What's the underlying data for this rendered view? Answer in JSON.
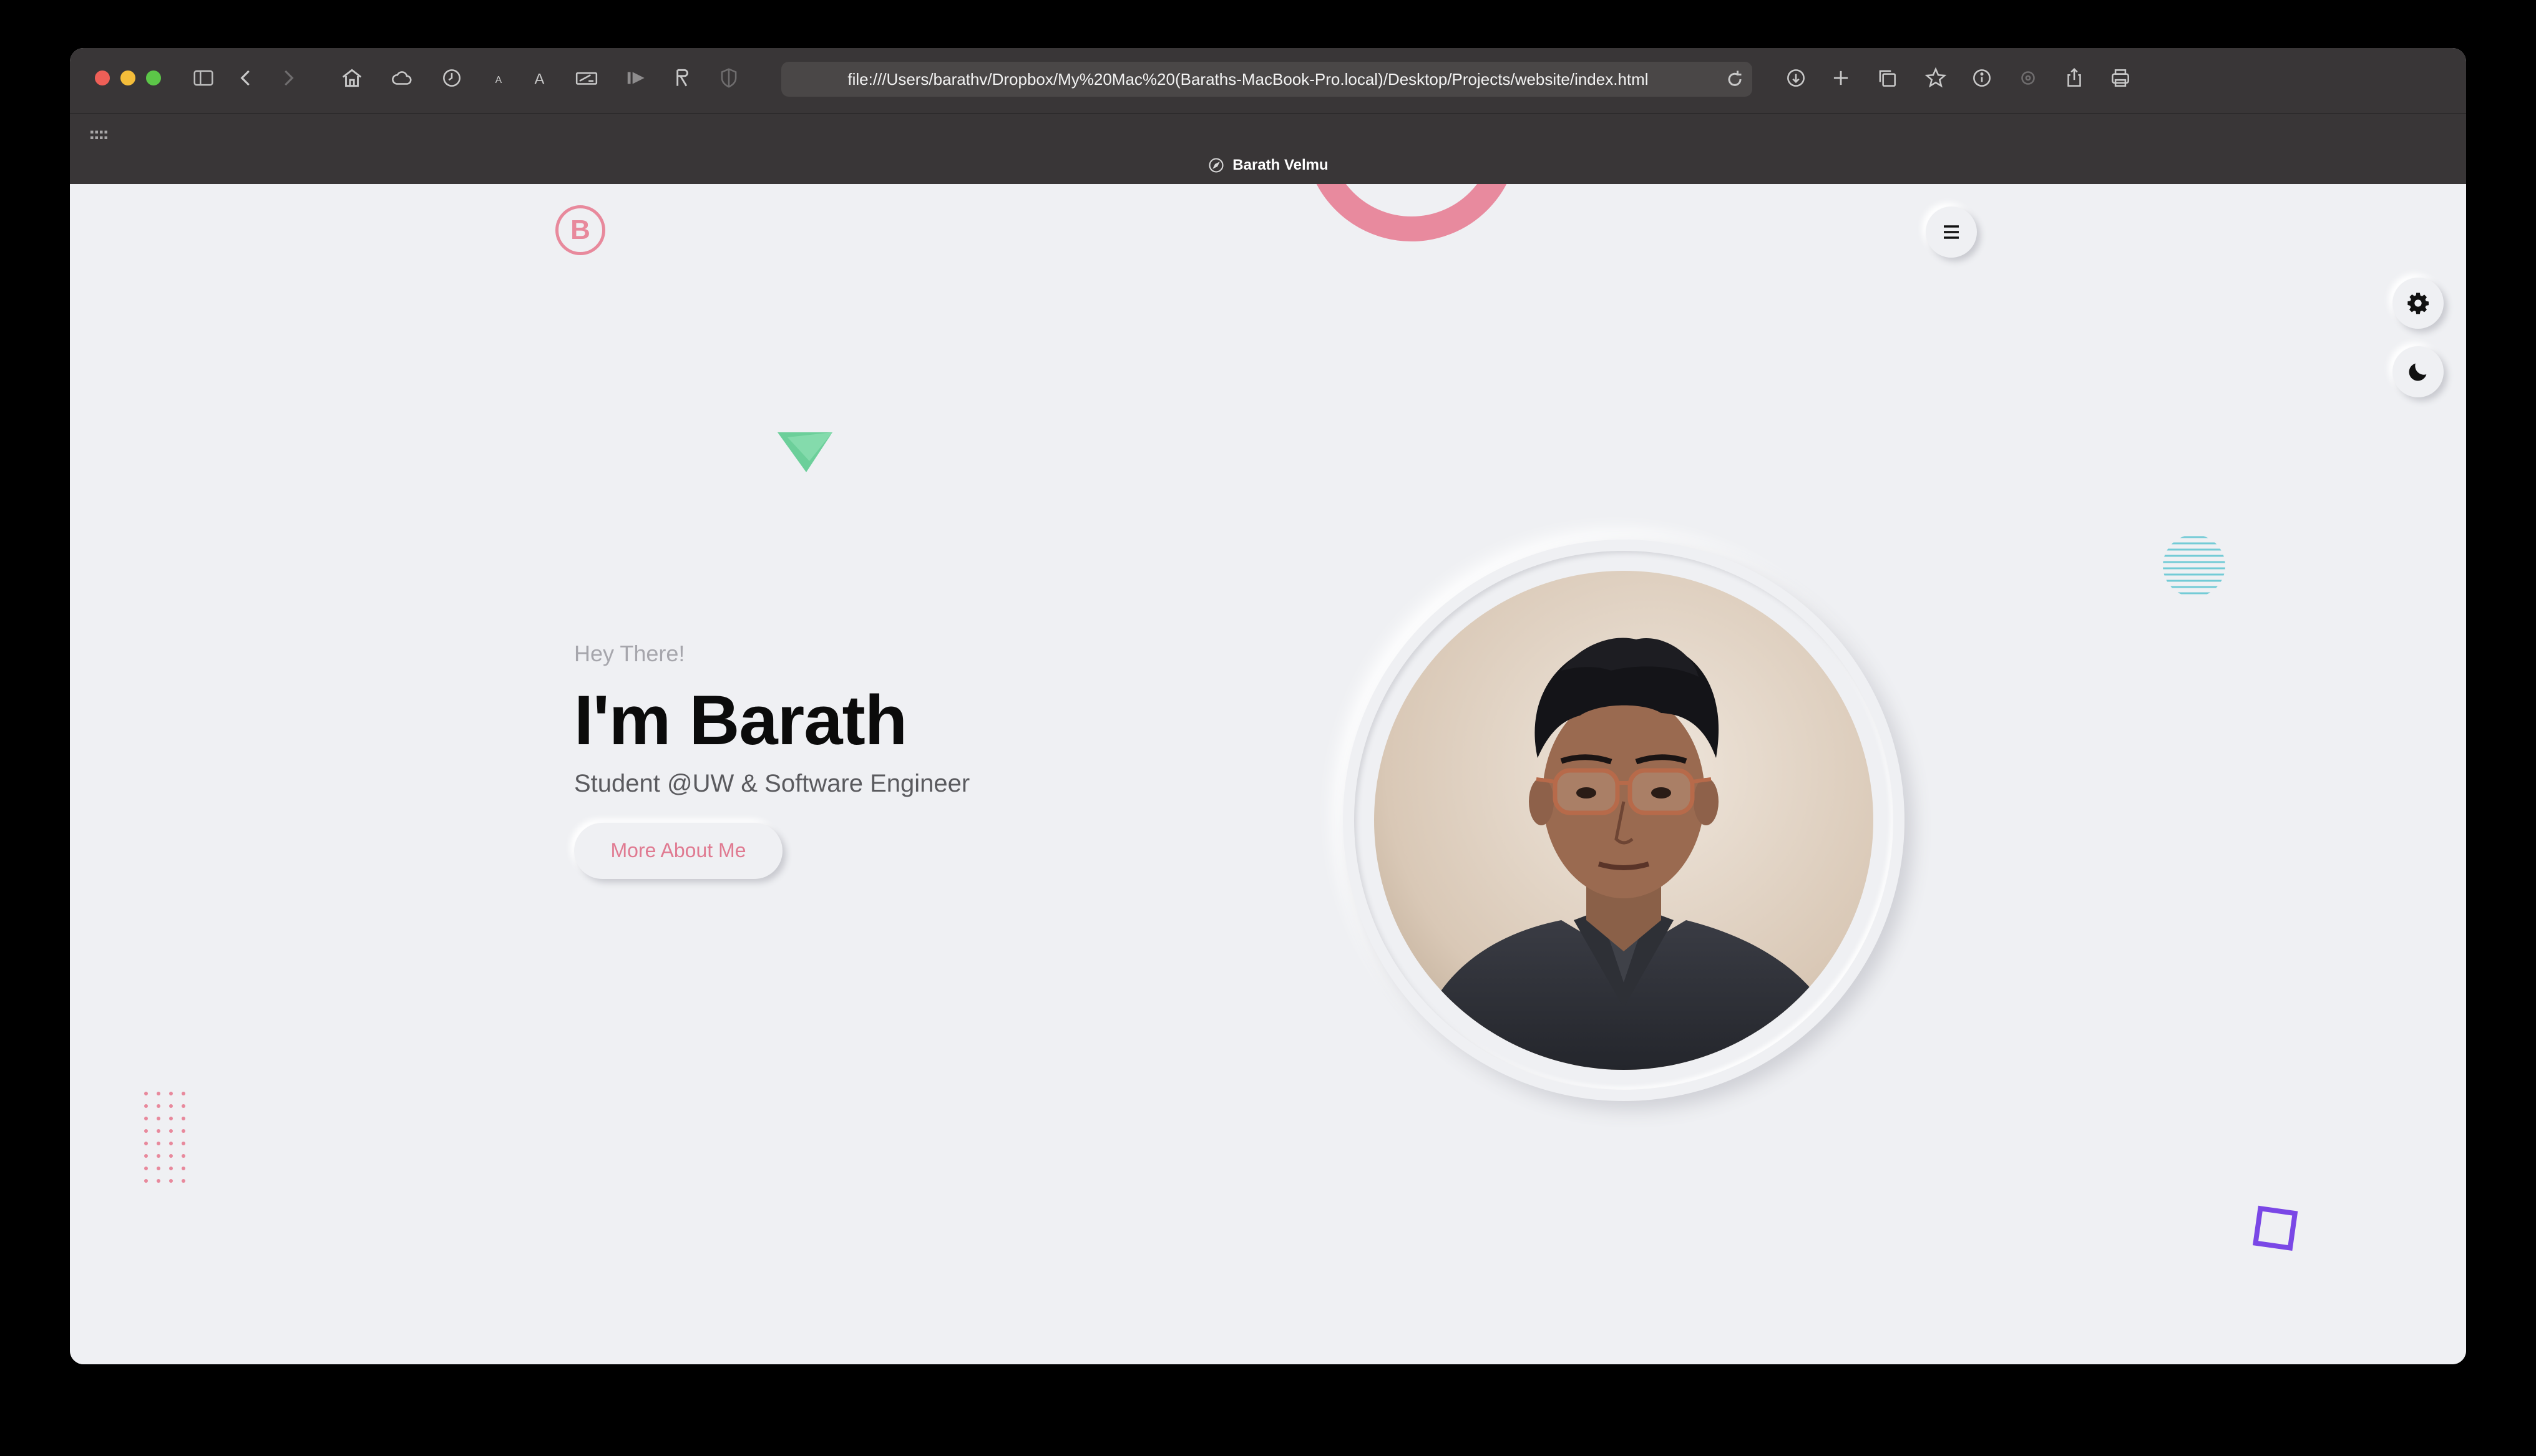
{
  "browser": {
    "url": "file:///Users/barathv/Dropbox/My%20Mac%20(Baraths-MacBook-Pro.local)/Desktop/Projects/website/index.html",
    "tab_title": "Barath Velmu",
    "toolbar_icons": [
      "sidebar-icon",
      "back-icon",
      "forward-icon",
      "home-icon",
      "cloud-icon",
      "history-icon",
      "text-smaller-icon",
      "text-larger-icon",
      "pen-icon",
      "reader-icon",
      "translate-icon",
      "shield-icon",
      "download-icon",
      "new-tab-icon",
      "tab-overview-icon",
      "bookmark-icon",
      "info-icon",
      "extension-icon",
      "share-icon",
      "print-icon"
    ]
  },
  "site": {
    "logo_letter": "B",
    "hero": {
      "greeting": "Hey There!",
      "headline": "I'm Barath",
      "subtitle": "Student @UW & Software Engineer",
      "cta_label": "More About Me"
    },
    "photo_alt": "Portrait of Barath",
    "colors": {
      "accent": "#e8899c",
      "background": "#eff0f3",
      "triangle": "#55c98a",
      "stripes": "#73cbd6",
      "square": "#7a47e6",
      "dots": "#e8899c"
    }
  }
}
